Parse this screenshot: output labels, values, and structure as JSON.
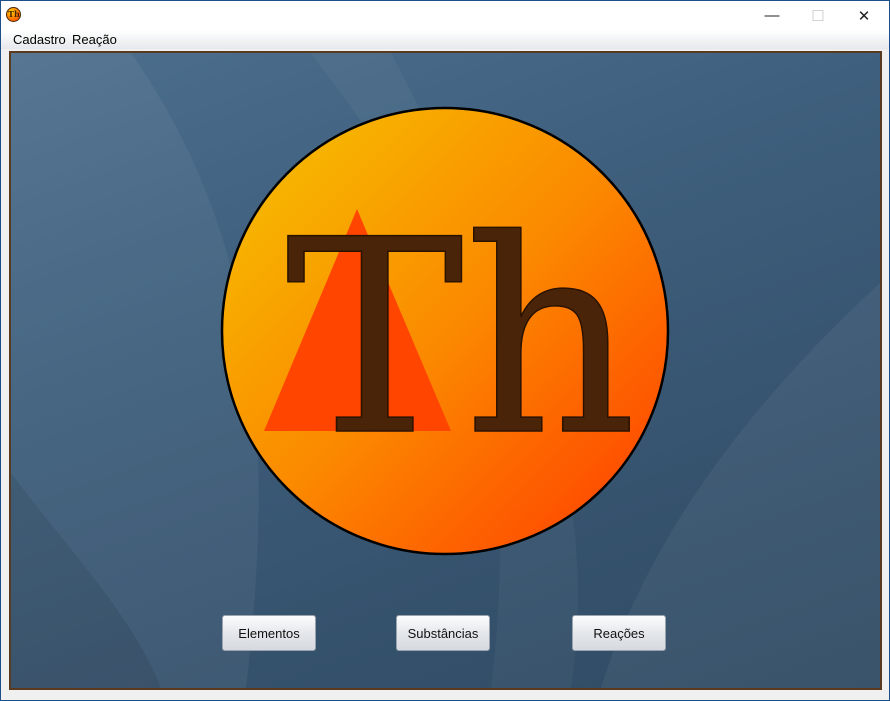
{
  "window": {
    "minimize_glyph": "—",
    "maximize_glyph": "☐",
    "close_glyph": "✕",
    "app_icon_text": "Th"
  },
  "menubar": {
    "items": [
      {
        "label": "Cadastro"
      },
      {
        "label": "Reação"
      }
    ]
  },
  "logo": {
    "text": "Th",
    "colors": {
      "circle_top": "#f5c400",
      "circle_mid": "#fb8a00",
      "circle_bottom": "#ff3a00",
      "triangle": "#ff4500",
      "letters": "#4a2408"
    }
  },
  "buttons": {
    "elementos": "Elementos",
    "substancias": "Substâncias",
    "reacoes": "Reações"
  },
  "colors": {
    "desktop_background": "#3e5f7d",
    "frame_border": "#5a3a1e"
  }
}
